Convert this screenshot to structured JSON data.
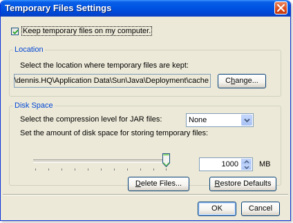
{
  "window": {
    "title": "Temporary Files Settings"
  },
  "keep_files": {
    "label": "Keep temporary files on my computer.",
    "checked": true
  },
  "location": {
    "legend": "Location",
    "instruction": "Select the location where temporary files are kept:",
    "path_value": "ngs\\dennis.HQ\\Application Data\\Sun\\Java\\Deployment\\cache",
    "change_pre": "C",
    "change_ul": "h",
    "change_post": "ange..."
  },
  "disk_space": {
    "legend": "Disk Space",
    "compression_label": "Select the compression level for JAR files:",
    "compression_value": "None",
    "space_label": "Set the amount of disk space for storing temporary files:",
    "space_value": "1000",
    "space_unit": "MB",
    "slider_fraction": 1.0
  },
  "buttons": {
    "delete_ul": "D",
    "delete_rest": "elete Files...",
    "restore_ul": "R",
    "restore_rest": "estore Defaults",
    "ok": "OK",
    "cancel": "Cancel"
  },
  "colors": {
    "title_blue": "#0054e3",
    "legend_blue": "#0046d5",
    "close_red": "#d84a1c",
    "face": "#ece9d8"
  }
}
